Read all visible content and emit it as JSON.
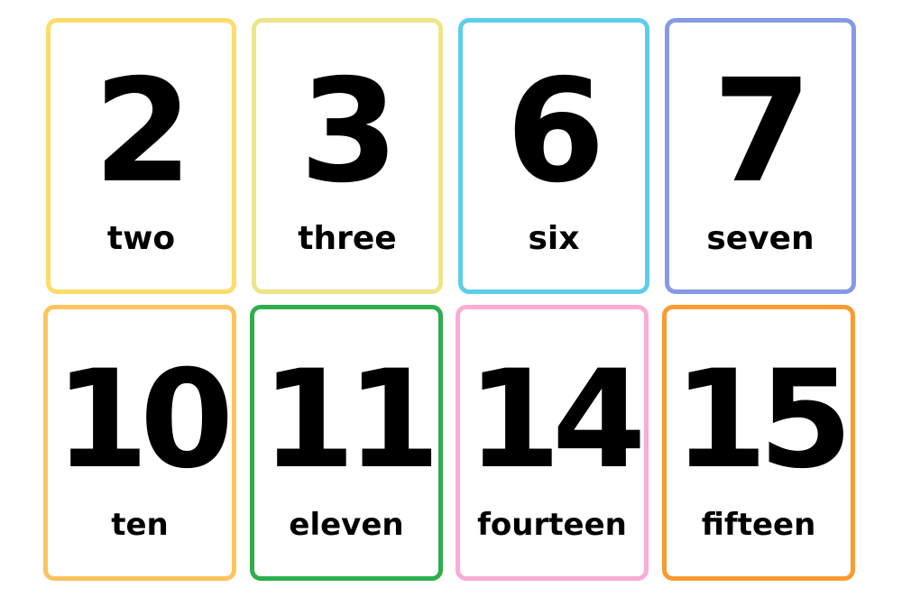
{
  "cards": [
    {
      "number": "2",
      "word": "two",
      "border_color": "#FDDC6B"
    },
    {
      "number": "3",
      "word": "three",
      "border_color": "#EDE58A"
    },
    {
      "number": "6",
      "word": "six",
      "border_color": "#5DCDEB"
    },
    {
      "number": "7",
      "word": "seven",
      "border_color": "#8599E6"
    },
    {
      "number": "10",
      "word": "ten",
      "border_color": "#FDC35D"
    },
    {
      "number": "11",
      "word": "eleven",
      "border_color": "#2EAE4C"
    },
    {
      "number": "14",
      "word": "fourteen",
      "border_color": "#F9ACD6"
    },
    {
      "number": "15",
      "word": "fifteen",
      "border_color": "#FB9B2F"
    }
  ]
}
